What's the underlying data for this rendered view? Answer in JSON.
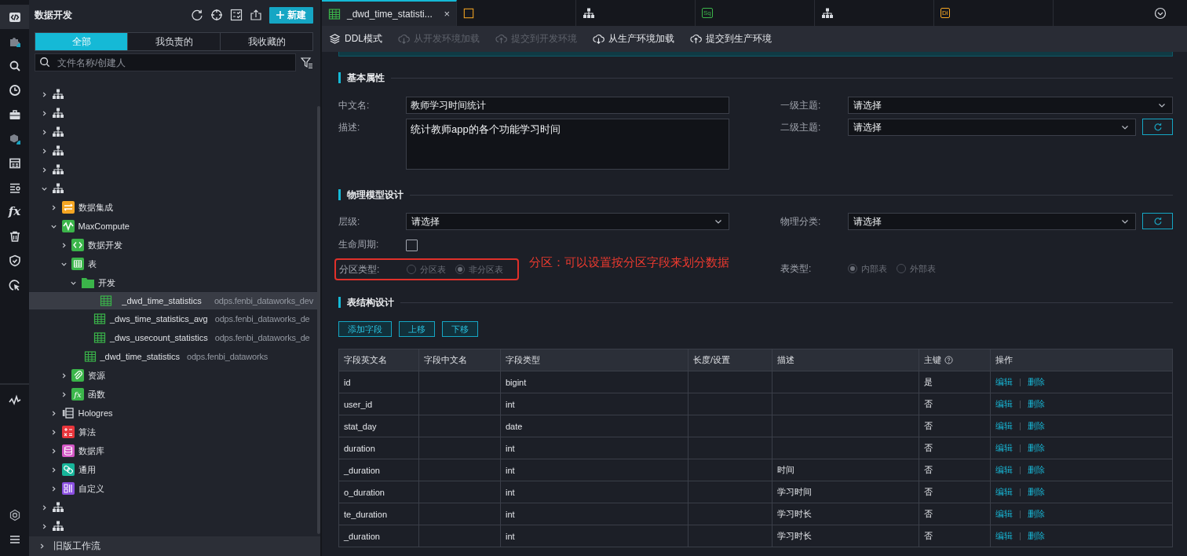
{
  "rail": [
    {
      "kind": "code",
      "selected": true
    },
    {
      "kind": "puzzle",
      "selected": false
    },
    {
      "kind": "search",
      "selected": false
    },
    {
      "kind": "clock",
      "selected": false
    },
    {
      "kind": "briefcase",
      "selected": false
    },
    {
      "kind": "cube",
      "selected": false
    },
    {
      "kind": "grid",
      "selected": false
    },
    {
      "kind": "list",
      "selected": false
    },
    {
      "kind": "fx",
      "glyph": "fx",
      "selected": false
    },
    {
      "kind": "trash",
      "selected": false
    },
    {
      "kind": "shield",
      "selected": false
    },
    {
      "kind": "cursor",
      "selected": false
    },
    {
      "kind": "pulse",
      "selected": false
    }
  ],
  "rail_bottom": [
    {
      "kind": "settings"
    },
    {
      "kind": "menu"
    }
  ],
  "explorer": {
    "title": "数据开发",
    "new_button": "新建",
    "filters": [
      {
        "label": "全部",
        "selected": true
      },
      {
        "label": "我负责的",
        "selected": false
      },
      {
        "label": "我收藏的",
        "selected": false
      }
    ],
    "search": {
      "placeholder": "文件名称/创建人"
    },
    "tree": [
      {
        "kind": "workflow",
        "expanded": false,
        "selected": false
      },
      {
        "kind": "workflow",
        "expanded": false,
        "selected": false
      },
      {
        "kind": "workflow",
        "expanded": false,
        "selected": false
      },
      {
        "kind": "workflow",
        "expanded": false,
        "selected": false
      },
      {
        "kind": "workflow",
        "expanded": false,
        "selected": false
      },
      {
        "kind": "workflow",
        "expanded": true,
        "selected": false,
        "children": [
          {
            "kind": "integration",
            "label": "数据集成",
            "expanded": false,
            "selected": false
          },
          {
            "kind": "maxcompute",
            "label": "MaxCompute",
            "expanded": true,
            "selected": false,
            "children": [
              {
                "kind": "dev",
                "label": "数据开发",
                "expanded": false,
                "selected": false
              },
              {
                "kind": "tables",
                "label": "表",
                "expanded": true,
                "selected": false,
                "children": [
                  {
                    "kind": "folder",
                    "label": "开发",
                    "expanded": true,
                    "selected": false,
                    "children": [
                      {
                        "kind": "table",
                        "label": "_dwd_time_statistics",
                        "sublabel": "odps.fenbi_dataworks_dev",
                        "selected": true
                      },
                      {
                        "kind": "table",
                        "label": "_dws_time_statistics_avg",
                        "sublabel": "odps.fenbi_dataworks_de",
                        "selected": false
                      },
                      {
                        "kind": "table",
                        "label": "_dws_usecount_statistics",
                        "sublabel": "odps.fenbi_dataworks_de",
                        "selected": false
                      }
                    ]
                  },
                  {
                    "kind": "table",
                    "label": "_dwd_time_statistics",
                    "sublabel": "odps.fenbi_dataworks",
                    "selected": false
                  }
                ]
              },
              {
                "kind": "resource",
                "label": "资源",
                "expanded": false,
                "selected": false
              },
              {
                "kind": "function",
                "label": "函数",
                "glyph": "fx",
                "expanded": false,
                "selected": false
              }
            ]
          },
          {
            "kind": "hologres",
            "label": "Hologres",
            "expanded": false,
            "selected": false
          },
          {
            "kind": "algorithm",
            "label": "算法",
            "expanded": false,
            "selected": false
          },
          {
            "kind": "database",
            "label": "数据库",
            "expanded": false,
            "selected": false
          },
          {
            "kind": "general",
            "label": "通用",
            "expanded": false,
            "selected": false
          },
          {
            "kind": "custom",
            "label": "自定义",
            "expanded": false,
            "selected": false
          }
        ]
      },
      {
        "kind": "workflow",
        "expanded": false,
        "selected": false
      },
      {
        "kind": "workflow",
        "expanded": false,
        "selected": false
      }
    ],
    "footer": "旧版工作流"
  },
  "tabs": [
    {
      "kind": "table",
      "label": "_dwd_time_statisti...",
      "selected": true,
      "close": "×"
    },
    {
      "kind": "file",
      "selected": false
    },
    {
      "kind": "workflow",
      "selected": false
    },
    {
      "kind": "sql",
      "badge": "Sq",
      "selected": false
    },
    {
      "kind": "workflow",
      "selected": false
    },
    {
      "kind": "di",
      "badge": "Di",
      "selected": false
    }
  ],
  "toolbar": [
    {
      "kind": "layers",
      "label": "DDL模式",
      "disabled": false
    },
    {
      "kind": "load",
      "label": "从开发环境加载",
      "disabled": true
    },
    {
      "kind": "submit",
      "label": "提交到开发环境",
      "disabled": true
    },
    {
      "kind": "load",
      "label": "从生产环境加载",
      "disabled": false
    },
    {
      "kind": "submit",
      "label": "提交到生产环境",
      "disabled": false
    }
  ],
  "basic": {
    "title": "基本属性",
    "name": {
      "label": "中文名:",
      "value": "教师学习时间统计"
    },
    "description": {
      "label": "描述:",
      "value": "统计教师app的各个功能学习时间"
    },
    "topic1": {
      "label": "一级主题:",
      "value": "请选择"
    },
    "topic2": {
      "label": "二级主题:",
      "value": "请选择"
    }
  },
  "physical": {
    "title": "物理模型设计",
    "layer": {
      "label": "层级:",
      "value": "请选择"
    },
    "category": {
      "label": "物理分类:",
      "value": "请选择"
    },
    "lifecycle": {
      "label": "生命周期:",
      "checked": false
    },
    "partition": {
      "label": "分区类型:",
      "disabled": true,
      "options": [
        {
          "label": "分区表",
          "selected": false
        },
        {
          "label": "非分区表",
          "selected": true
        }
      ]
    },
    "annotation": "分区：可以设置按分区字段来划分数据",
    "table_type": {
      "label": "表类型:",
      "disabled": true,
      "options": [
        {
          "label": "内部表",
          "selected": true
        },
        {
          "label": "外部表",
          "selected": false
        }
      ]
    }
  },
  "schema": {
    "title": "表结构设计",
    "buttons": [
      "添加字段",
      "上移",
      "下移"
    ],
    "columns": [
      {
        "label": "字段英文名"
      },
      {
        "label": "字段中文名"
      },
      {
        "label": "字段类型"
      },
      {
        "label": "长度/设置"
      },
      {
        "label": "描述"
      },
      {
        "label": "主键",
        "help": true
      },
      {
        "label": "操作"
      }
    ],
    "rows": [
      {
        "name": "id",
        "type": "bigint",
        "primary_key": "是",
        "actions": [
          "编辑",
          "删除"
        ]
      },
      {
        "name": "user_id",
        "type": "int",
        "primary_key": "否",
        "actions": [
          "编辑",
          "删除"
        ]
      },
      {
        "name": "stat_day",
        "type": "date",
        "primary_key": "否",
        "actions": [
          "编辑",
          "删除"
        ]
      },
      {
        "name": "duration",
        "type": "int",
        "primary_key": "否",
        "actions": [
          "编辑",
          "删除"
        ]
      },
      {
        "name": "_duration",
        "type": "int",
        "description": "时间",
        "primary_key": "否",
        "actions": [
          "编辑",
          "删除"
        ]
      },
      {
        "name": "o_duration",
        "type": "int",
        "description": "学习时间",
        "primary_key": "否",
        "actions": [
          "编辑",
          "删除"
        ]
      },
      {
        "name": "te_duration",
        "type": "int",
        "description": "学习时长",
        "primary_key": "否",
        "actions": [
          "编辑",
          "删除"
        ]
      },
      {
        "name": "_duration",
        "type": "int",
        "description": "学习时长",
        "primary_key": "否",
        "actions": [
          "编辑",
          "删除"
        ]
      }
    ]
  }
}
